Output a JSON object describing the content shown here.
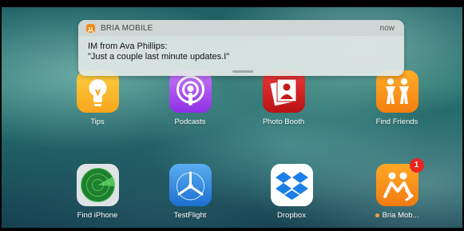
{
  "notification": {
    "app_name": "BRIA MOBILE",
    "time": "now",
    "title": "IM from Ava Phillips:",
    "body": "\"Just a couple last minute updates.I\""
  },
  "apps": [
    {
      "id": "tips",
      "label": "Tips",
      "icon": "lightbulb-icon"
    },
    {
      "id": "podcasts",
      "label": "Podcasts",
      "icon": "podcasts-icon"
    },
    {
      "id": "photobooth",
      "label": "Photo Booth",
      "icon": "photo-booth-icon"
    },
    {
      "id": "findfriends",
      "label": "Find Friends",
      "icon": "find-friends-icon"
    },
    {
      "id": "findiphone",
      "label": "Find iPhone",
      "icon": "radar-icon"
    },
    {
      "id": "testflight",
      "label": "TestFlight",
      "icon": "propeller-icon"
    },
    {
      "id": "dropbox",
      "label": "Dropbox",
      "icon": "dropbox-icon"
    },
    {
      "id": "bria",
      "label": "Bria Mob...",
      "icon": "bria-icon",
      "badge": "1"
    }
  ],
  "colors": {
    "badge": "#e8281e",
    "bria_brand": "#f27b12"
  }
}
